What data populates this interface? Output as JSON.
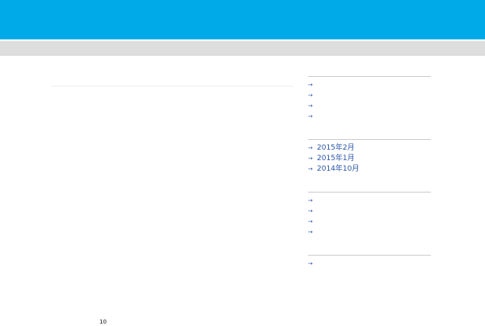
{
  "header": {
    "site_title": "",
    "site_description": "",
    "background_color": "#00a9e8"
  },
  "nav": {
    "items": [
      {
        "label": ""
      },
      {
        "label": ""
      }
    ]
  },
  "post": {
    "title": "",
    "paragraphs": [
      {
        "text": ""
      },
      {
        "text": ""
      },
      {
        "text": ""
      },
      {
        "text": ""
      },
      {
        "text": ""
      },
      {
        "text": ""
      },
      {
        "text": ""
      },
      {
        "text": ""
      },
      {
        "text": ""
      },
      {
        "text": ""
      },
      {
        "text": ""
      },
      {
        "text": ""
      },
      {
        "text": ""
      },
      {
        "text": ""
      },
      {
        "text": ""
      },
      {
        "text": ""
      },
      {
        "text": ""
      },
      {
        "text": ""
      },
      {
        "text": ""
      },
      {
        "text": "10"
      }
    ]
  },
  "sidebar": {
    "link_color": "#2a55a8",
    "recent_posts": {
      "title": "",
      "items": [
        {
          "label": ""
        },
        {
          "label": ""
        },
        {
          "label": ""
        },
        {
          "label": ""
        }
      ]
    },
    "archives": {
      "title": "",
      "items": [
        {
          "label": "2015年2月"
        },
        {
          "label": "2015年1月"
        },
        {
          "label": "2014年10月"
        }
      ]
    },
    "categories": {
      "title": "",
      "items": [
        {
          "label": ""
        },
        {
          "label": ""
        },
        {
          "label": ""
        },
        {
          "label": ""
        }
      ]
    },
    "meta": {
      "title": "",
      "items": [
        {
          "label": ""
        }
      ]
    }
  }
}
